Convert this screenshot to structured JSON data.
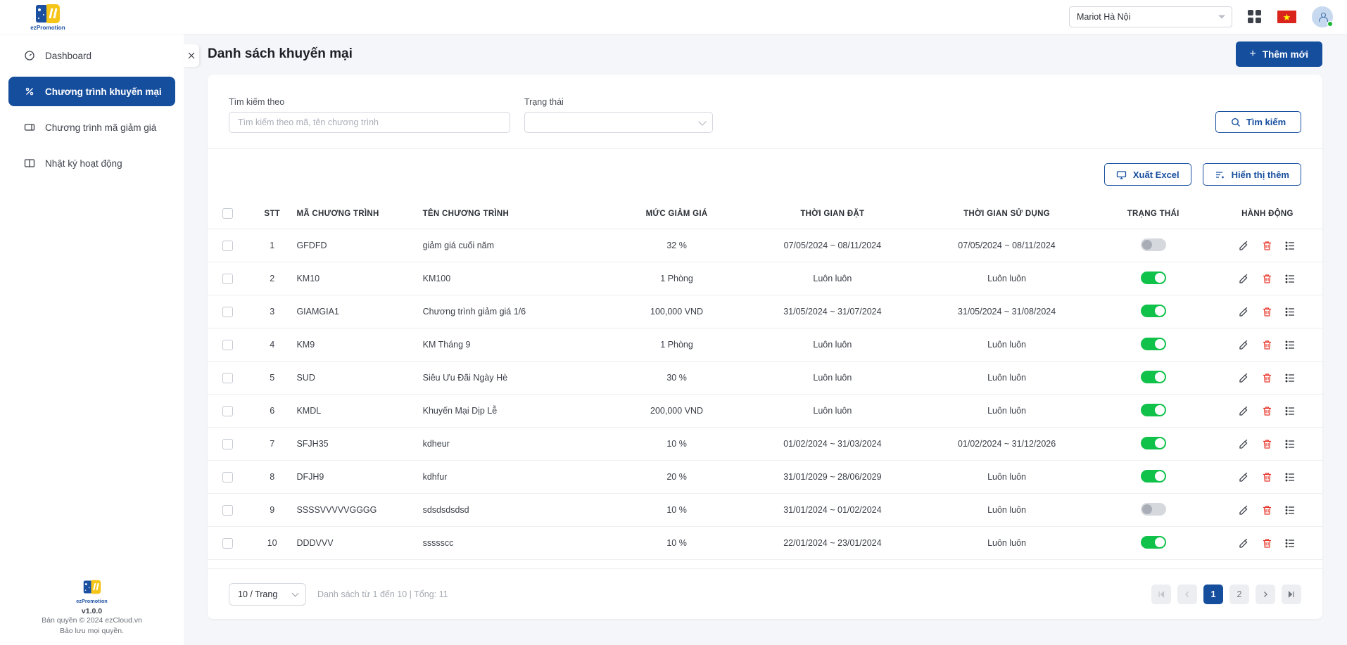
{
  "topbar": {
    "brand": {
      "ez": "ez",
      "promotion": "Promotion"
    },
    "hotel_selected": "Mariot Hà Nội",
    "apps_icon": "grid-apps-icon",
    "flag_icon": "vietnam-flag-icon",
    "flag_star": "★",
    "avatar_icon": "user-avatar-icon"
  },
  "sidebar": {
    "items": [
      {
        "label": "Dashboard",
        "icon": "dashboard-icon",
        "active": false
      },
      {
        "label": "Chương trình khuyến mại",
        "icon": "percent-icon",
        "active": true
      },
      {
        "label": "Chương trình mã giảm giá",
        "icon": "ticket-icon",
        "active": false
      },
      {
        "label": "Nhật ký hoạt động",
        "icon": "book-icon",
        "active": false
      }
    ],
    "footer": {
      "version": "v1.0.0",
      "copyright": "Bản quyền © 2024 ezCloud.vn",
      "rights": "Bảo lưu mọi quyền."
    },
    "collapse_icon": "collapse-sidebar-icon"
  },
  "page": {
    "title": "Danh sách khuyến mại",
    "add_button": "Thêm mới",
    "add_button_plus": "+"
  },
  "filters": {
    "search_label": "Tìm kiếm theo",
    "search_placeholder": "Tìm kiếm theo mã, tên chương trình",
    "search_value": "",
    "status_label": "Trạng thái",
    "status_value": "",
    "search_button": "Tìm kiếm"
  },
  "tools": {
    "export_excel": "Xuất Excel",
    "show_more": "Hiển thị thêm"
  },
  "table": {
    "columns": [
      "STT",
      "MÃ CHƯƠNG TRÌNH",
      "TÊN CHƯƠNG TRÌNH",
      "MỨC GIẢM GIÁ",
      "THỜI GIAN ĐẶT",
      "THỜI GIAN SỬ DỤNG",
      "TRẠNG THÁI",
      "HÀNH ĐỘNG"
    ],
    "rows": [
      {
        "stt": "1",
        "code": "GFDFD",
        "name": "giảm giá cuối năm",
        "discount": "32 %",
        "booking_time": "07/05/2024 ~ 08/11/2024",
        "usage_time": "07/05/2024 ~ 08/11/2024",
        "active": false
      },
      {
        "stt": "2",
        "code": "KM10",
        "name": "KM100",
        "discount": "1 Phòng",
        "booking_time": "Luôn luôn",
        "usage_time": "Luôn luôn",
        "active": true
      },
      {
        "stt": "3",
        "code": "GIAMGIA1",
        "name": "Chương trình giảm giá 1/6",
        "discount": "100,000 VND",
        "booking_time": "31/05/2024 ~ 31/07/2024",
        "usage_time": "31/05/2024 ~ 31/08/2024",
        "active": true
      },
      {
        "stt": "4",
        "code": "KM9",
        "name": "KM Tháng 9",
        "discount": "1 Phòng",
        "booking_time": "Luôn luôn",
        "usage_time": "Luôn luôn",
        "active": true
      },
      {
        "stt": "5",
        "code": "SUD",
        "name": "Siêu Ưu Đãi Ngày Hè",
        "discount": "30 %",
        "booking_time": "Luôn luôn",
        "usage_time": "Luôn luôn",
        "active": true
      },
      {
        "stt": "6",
        "code": "KMDL",
        "name": "Khuyến Mại Dịp Lễ",
        "discount": "200,000 VND",
        "booking_time": "Luôn luôn",
        "usage_time": "Luôn luôn",
        "active": true
      },
      {
        "stt": "7",
        "code": "SFJH35",
        "name": "kdheur",
        "discount": "10 %",
        "booking_time": "01/02/2024 ~ 31/03/2024",
        "usage_time": "01/02/2024 ~ 31/12/2026",
        "active": true
      },
      {
        "stt": "8",
        "code": "DFJH9",
        "name": "kdhfur",
        "discount": "20 %",
        "booking_time": "31/01/2029 ~ 28/06/2029",
        "usage_time": "Luôn luôn",
        "active": true
      },
      {
        "stt": "9",
        "code": "SSSSVVVVVGGGG",
        "name": "sdsdsdsdsd",
        "discount": "10 %",
        "booking_time": "31/01/2024 ~ 01/02/2024",
        "usage_time": "Luôn luôn",
        "active": false
      },
      {
        "stt": "10",
        "code": "DDDVVV",
        "name": "ssssscc",
        "discount": "10 %",
        "booking_time": "22/01/2024 ~ 23/01/2024",
        "usage_time": "Luôn luôn",
        "active": true
      }
    ],
    "row_action_icons": [
      "edit-icon",
      "delete-icon",
      "list-detail-icon"
    ]
  },
  "pagination": {
    "page_size": "10 / Trang",
    "range_text": "Danh sách từ 1 đến 10 | Tổng: 11",
    "first": "|◁",
    "prev": "‹",
    "pages": [
      "1",
      "2"
    ],
    "current_page": "1",
    "next": "›",
    "last": "▷|"
  },
  "colors": {
    "primary": "#164e9e",
    "toggle_on": "#10c24a",
    "danger": "#e8392d",
    "flag_red": "#da251d"
  }
}
